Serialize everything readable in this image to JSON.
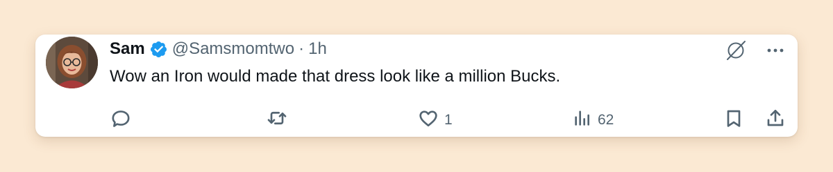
{
  "tweet": {
    "author_name": "Sam",
    "handle": "@Samsmomtwo",
    "separator": "·",
    "time": "1h",
    "text": "Wow an Iron would made that dress look like a million Bucks.",
    "verified": true
  },
  "icons": {
    "verified": "verified-badge-icon",
    "grok": "grok-icon",
    "more": "more-icon",
    "reply": "reply-icon",
    "retweet": "retweet-icon",
    "like": "like-icon",
    "views": "views-icon",
    "bookmark": "bookmark-icon",
    "share": "share-icon"
  },
  "stats": {
    "likes": "1",
    "views": "62"
  },
  "colors": {
    "background": "#fbe9d3",
    "verified": "#1d9bf0",
    "muted": "#536471",
    "text": "#0f1419"
  }
}
